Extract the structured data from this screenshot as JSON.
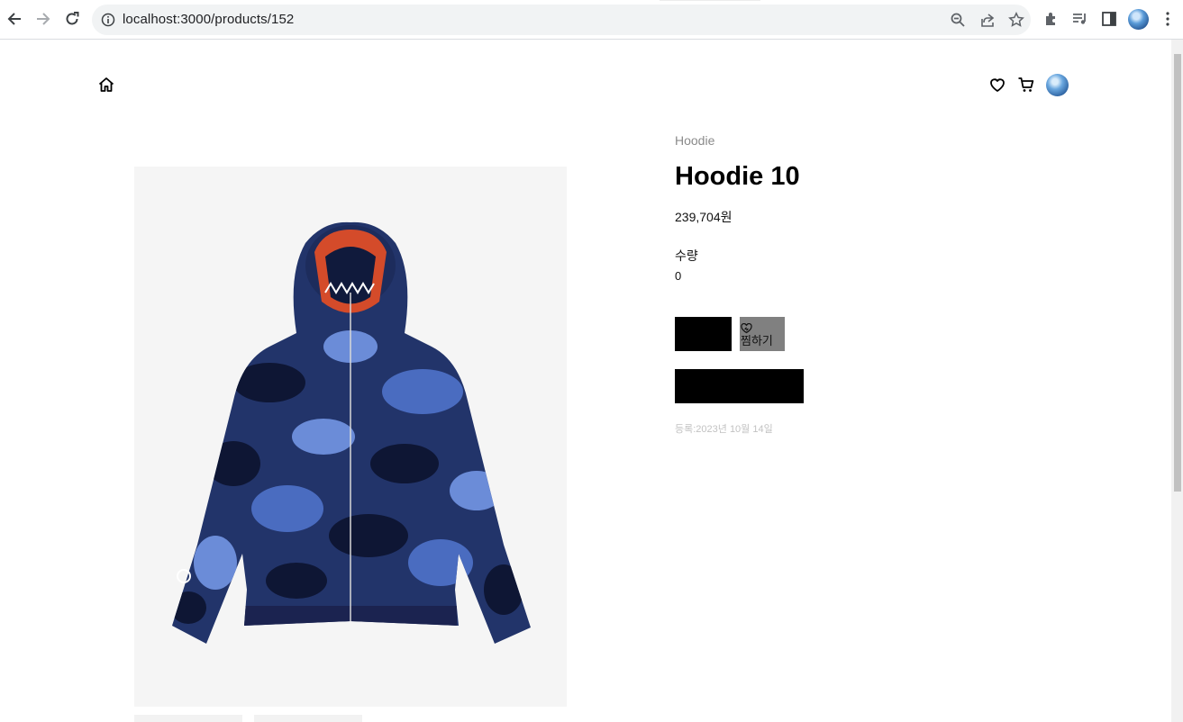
{
  "browser": {
    "url": "localhost:3000/products/152"
  },
  "product": {
    "category": "Hoodie",
    "name": "Hoodie 10",
    "price": "239,704원",
    "quantity_label": "수량",
    "quantity_value": "0",
    "like_label": "찜하기",
    "registered": "등록:2023년 10월 14일",
    "image_description_colors": [
      "#1b2a55",
      "#3e5fa8",
      "#6d8fd6",
      "#0d1430"
    ]
  },
  "icons": {
    "home": "home-icon",
    "wishlist": "heart-icon",
    "cart": "cart-icon",
    "profile": "avatar"
  }
}
